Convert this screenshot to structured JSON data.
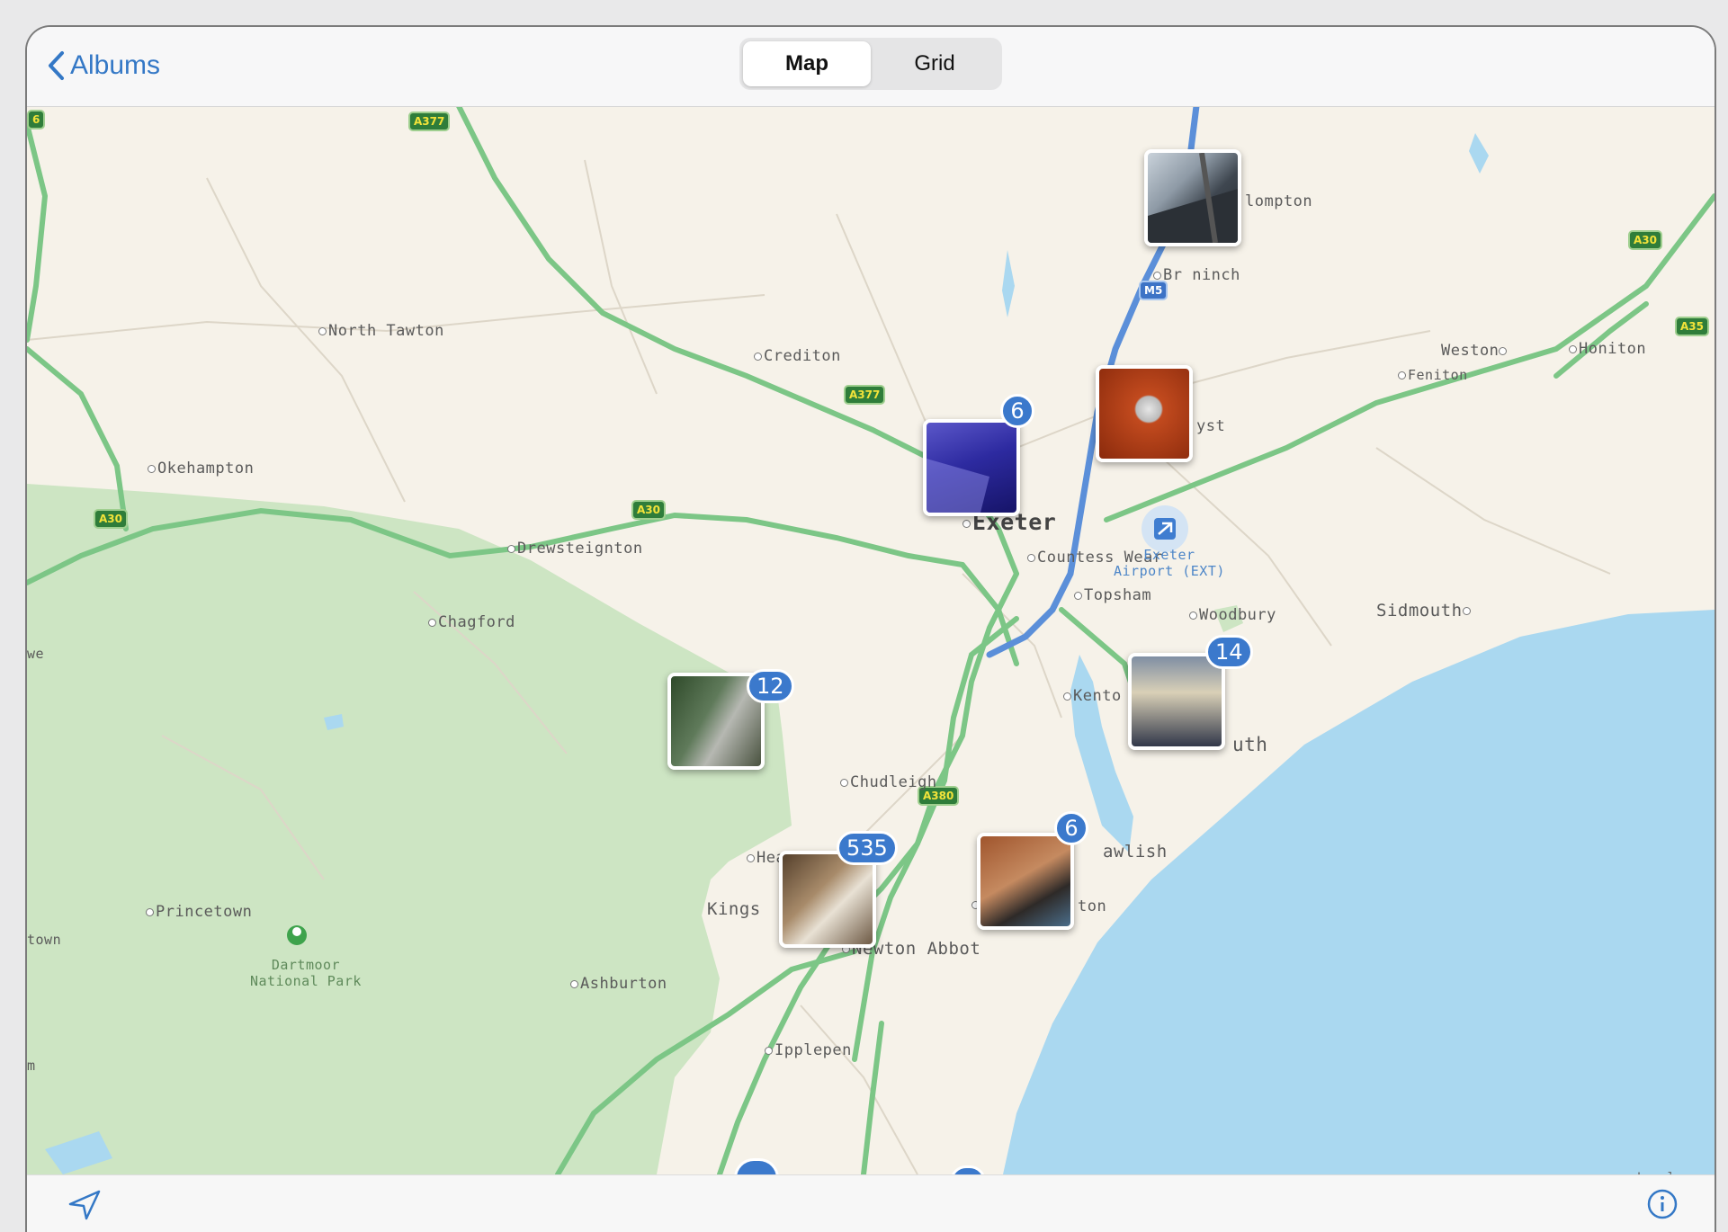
{
  "navbar": {
    "back_label": "Albums",
    "segments": [
      "Map",
      "Grid"
    ],
    "active_segment": "Map"
  },
  "map": {
    "places": {
      "north_tawton": "North Tawton",
      "crediton": "Crediton",
      "okehampton": "Okehampton",
      "drewsteignton": "Drewsteignton",
      "exeter": "Exeter",
      "countess_wear": "Countess Wear",
      "topsham": "Topsham",
      "woodbury": "Woodbury",
      "sidmouth": "Sidmouth",
      "chagford": "Chagford",
      "kenton": "Kento",
      "exmouth": "uth",
      "chudleigh": "Chudleigh",
      "dawlish": "awlish",
      "heathfield": "Heathfi",
      "kings": "Kings",
      "newton_abbot": "Newton Abbot",
      "ashburton": "Ashburton",
      "princetown": "Princetown",
      "ipplepen": "Ipplepen",
      "weston": "Weston",
      "honiton": "Honiton",
      "feniton": "Feniton",
      "broadclyst": "yst",
      "cullompton": "lompton",
      "bradninch": "Br  ninch",
      "teignmouth": "ton",
      "edge_left_1": "we",
      "edge_left_2": "town",
      "edge_left_3": "m"
    },
    "airport": [
      "Exeter",
      "Airport (EXT)"
    ],
    "park": [
      "Dartmoor",
      "National Park"
    ],
    "roads": {
      "a377_top": "A377",
      "a377_mid": "A377",
      "a30_left": "A30",
      "a30_mid": "A30",
      "a30_right": "A30",
      "a35": "A35",
      "a380": "A380",
      "m5": "M5",
      "edge": "6"
    },
    "clusters": [
      {
        "id": "cullompton",
        "count": ""
      },
      {
        "id": "exeter-north",
        "count": "6"
      },
      {
        "id": "broadclyst",
        "count": ""
      },
      {
        "id": "dartmoor",
        "count": "12"
      },
      {
        "id": "exmouth",
        "count": "14"
      },
      {
        "id": "newton-abbot",
        "count": "535"
      },
      {
        "id": "dawlish",
        "count": "6"
      }
    ],
    "legal": "Legal"
  },
  "toolbar": {
    "location_icon": "location-arrow-icon",
    "info_icon": "info-icon"
  },
  "colors": {
    "accent": "#3478c6",
    "badge": "#3b79cc",
    "water": "#aad8f0",
    "park": "#cde5c3",
    "road": "#7cc686",
    "motorway": "#5b8fd9",
    "land": "#f6f2e9"
  }
}
